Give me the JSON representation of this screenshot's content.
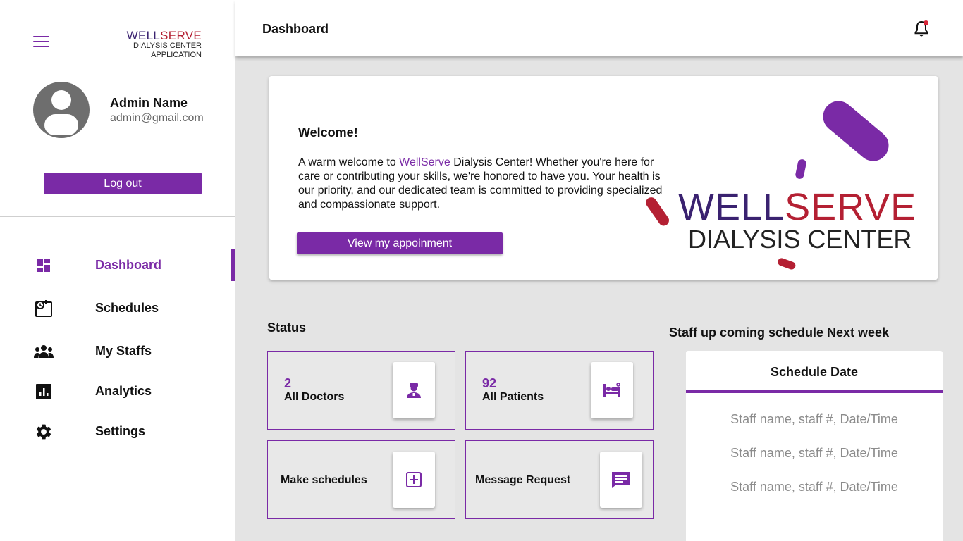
{
  "brand": {
    "name_part1": "WELL",
    "name_part2": "SERVE",
    "line2": "DIALYSIS CENTER",
    "line3": "APPLICATION"
  },
  "user": {
    "name": "Admin Name",
    "email": "admin@gmail.com",
    "logout_label": "Log out"
  },
  "sidebar": {
    "items": [
      {
        "label": "Dashboard",
        "icon": "dashboard-icon",
        "active": true
      },
      {
        "label": "Schedules",
        "icon": "schedule-icon",
        "active": false
      },
      {
        "label": "My Staffs",
        "icon": "staff-group-icon",
        "active": false
      },
      {
        "label": "Analytics",
        "icon": "analytics-icon",
        "active": false
      },
      {
        "label": "Settings",
        "icon": "gear-icon",
        "active": false
      }
    ]
  },
  "header": {
    "title": "Dashboard",
    "notification_icon": "bell-icon"
  },
  "welcome": {
    "title": "Welcome!",
    "text_before": "A warm welcome to ",
    "text_highlight": "WellServe",
    "text_after": " Dialysis Center! Whether you're here for care or contributing your skills, we're honored to have you. Your health is our priority, and our dedicated team is committed to providing specialized and compassionate support.",
    "button_label": "View my appoinment",
    "logo_word1": "WELL",
    "logo_word2": "SERVE",
    "logo_line2": "DIALYSIS CENTER"
  },
  "status": {
    "title": "Status",
    "cards": [
      {
        "value": "2",
        "label": "All Doctors",
        "icon": "doctor-icon"
      },
      {
        "value": "92",
        "label": "All Patients",
        "icon": "patient-bed-icon"
      },
      {
        "label": "Make schedules",
        "icon": "add-box-icon"
      },
      {
        "label": "Message Request",
        "icon": "message-icon"
      }
    ]
  },
  "schedule": {
    "title": "Staff up coming schedule Next week",
    "header": "Schedule Date",
    "rows": [
      "Staff name, staff #, Date/Time",
      "Staff name, staff #, Date/Time",
      "Staff name, staff #, Date/Time"
    ]
  },
  "colors": {
    "accent": "#7a2aa6",
    "brand_red": "#b42033",
    "brand_navy": "#3a2270",
    "notification_dot": "#d8283a"
  }
}
